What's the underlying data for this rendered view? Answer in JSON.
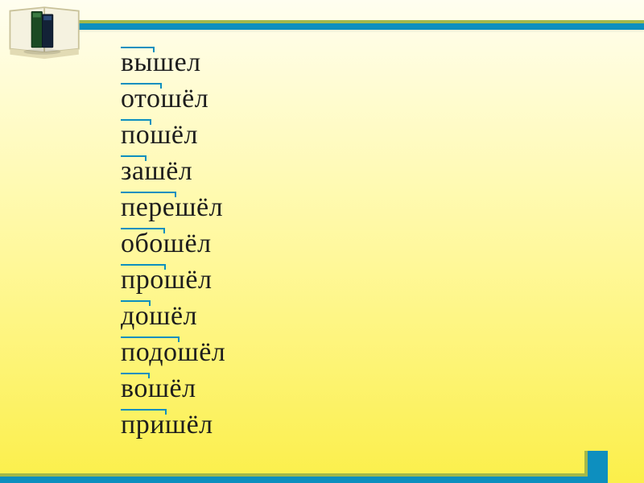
{
  "slide": {
    "words": [
      {
        "text": "вышел",
        "prefix_chars": 2
      },
      {
        "text": "отошёл",
        "prefix_chars": 3
      },
      {
        "text": "пошёл",
        "prefix_chars": 2
      },
      {
        "text": "зашёл",
        "prefix_chars": 2
      },
      {
        "text": "перешёл",
        "prefix_chars": 4
      },
      {
        "text": "обошёл",
        "prefix_chars": 3
      },
      {
        "text": "прошёл",
        "prefix_chars": 3
      },
      {
        "text": "дошёл",
        "prefix_chars": 2
      },
      {
        "text": "подошёл",
        "prefix_chars": 4
      },
      {
        "text": "вошёл",
        "prefix_chars": 2
      },
      {
        "text": "пришёл",
        "prefix_chars": 3
      }
    ],
    "colors": {
      "accent_blue": "#0d8fbf",
      "accent_olive": "#a2b84b",
      "text": "#1d1d1d"
    },
    "icon_name": "books-icon"
  }
}
